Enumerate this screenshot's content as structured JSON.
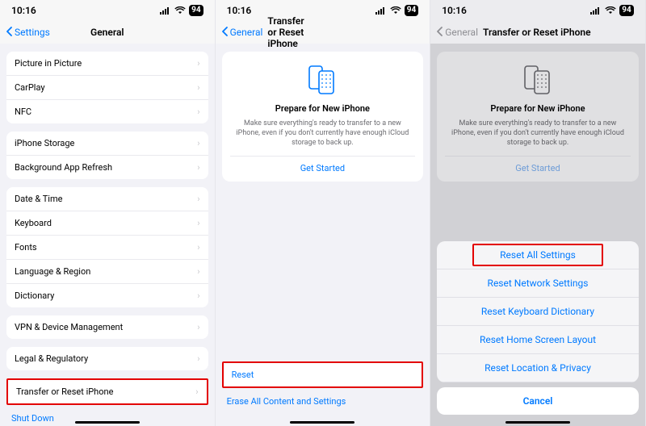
{
  "statusbar": {
    "time": "10:16",
    "battery": "94"
  },
  "panel1": {
    "nav": {
      "back": "Settings",
      "title": "General"
    },
    "group1": [
      "Picture in Picture",
      "CarPlay",
      "NFC"
    ],
    "group2": [
      "iPhone Storage",
      "Background App Refresh"
    ],
    "group3": [
      "Date & Time",
      "Keyboard",
      "Fonts",
      "Language & Region",
      "Dictionary"
    ],
    "group4": [
      "VPN & Device Management"
    ],
    "group5": [
      "Legal & Regulatory"
    ],
    "group6": [
      "Transfer or Reset iPhone"
    ],
    "shutdown": "Shut Down"
  },
  "panel2": {
    "nav": {
      "back": "General",
      "title": "Transfer or Reset iPhone"
    },
    "prepare": {
      "title": "Prepare for New iPhone",
      "desc": "Make sure everything's ready to transfer to a new iPhone, even if you don't currently have enough iCloud storage to back up.",
      "cta": "Get Started"
    },
    "reset": "Reset",
    "erase": "Erase All Content and Settings"
  },
  "panel3": {
    "nav": {
      "back": "General",
      "title": "Transfer or Reset iPhone"
    },
    "prepare": {
      "title": "Prepare for New iPhone",
      "desc": "Make sure everything's ready to transfer to a new iPhone, even if you don't currently have enough iCloud storage to back up.",
      "cta": "Get Started"
    },
    "sheet": {
      "options": [
        "Reset All Settings",
        "Reset Network Settings",
        "Reset Keyboard Dictionary",
        "Reset Home Screen Layout",
        "Reset Location & Privacy"
      ],
      "cancel": "Cancel"
    }
  },
  "highlight_color": "#e30000",
  "accent_color": "#007aff"
}
